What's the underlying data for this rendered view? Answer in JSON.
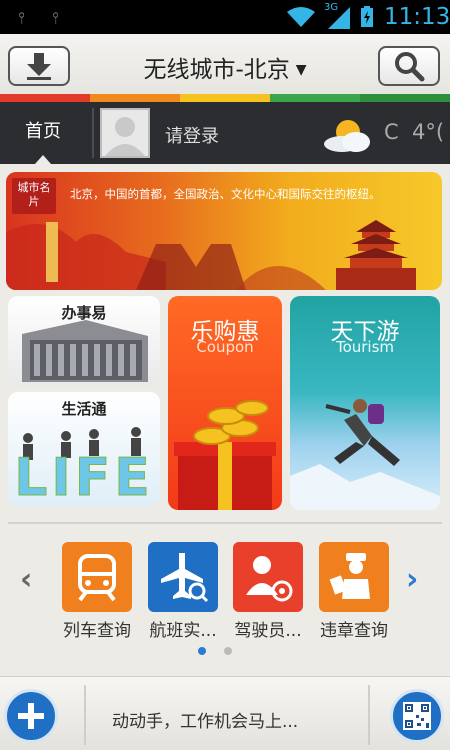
{
  "status_bar": {
    "time": "11:13",
    "network": "3G"
  },
  "header": {
    "city_title": "无线城市-北京",
    "download_icon": "download-icon",
    "search_icon": "search-icon"
  },
  "color_strip": [
    "#e23b2a",
    "#f08a1c",
    "#f6c21f",
    "#3aa54a",
    "#2d8f3c"
  ],
  "nav": {
    "home_tab": "首页",
    "login_text": "请登录",
    "temperature_unit": "C",
    "temperature": "4°("
  },
  "banner": {
    "badge": "城市名片",
    "text": "北京，中国的首都，全国政治、文化中心和国际交往的枢纽。"
  },
  "tiles": {
    "office": {
      "title": "办事易"
    },
    "life": {
      "title": "生活通",
      "logo_text": "LIFE"
    },
    "coupon": {
      "title": "乐购惠",
      "subtitle": "Coupon"
    },
    "tour": {
      "title": "天下游",
      "subtitle": "Tourism"
    }
  },
  "services": [
    {
      "label": "列车查询",
      "icon": "train-icon",
      "color": "#f07f1e"
    },
    {
      "label": "航班实...",
      "icon": "airplane-search-icon",
      "color": "#1f6fc5"
    },
    {
      "label": "驾驶员...",
      "icon": "driver-icon",
      "color": "#e8402a"
    },
    {
      "label": "违章查询",
      "icon": "traffic-police-icon",
      "color": "#f07f1e"
    }
  ],
  "pager": {
    "total": 2,
    "active": 1
  },
  "bottom": {
    "ticker": "动动手，工作机会马上...",
    "add_icon": "plus-icon",
    "qr_icon": "qr-code-icon"
  }
}
